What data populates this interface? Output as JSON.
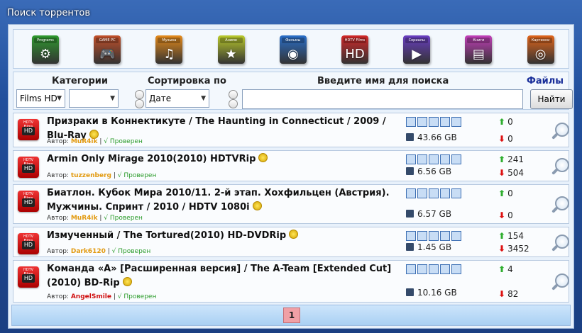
{
  "window": {
    "title": "Поиск торрентов"
  },
  "categories": [
    {
      "tag": "Programs",
      "glyph": "⚙",
      "color": "#2e9a2e",
      "icon": "programs-icon"
    },
    {
      "tag": "GAME PC",
      "glyph": "🎮",
      "color": "#c2502a",
      "icon": "games-icon"
    },
    {
      "tag": "Музыка",
      "glyph": "♫",
      "color": "#e58a1a",
      "icon": "music-icon"
    },
    {
      "tag": "Аниме",
      "glyph": "★",
      "color": "#b9c92b",
      "icon": "anime-icon"
    },
    {
      "tag": "Фильмы",
      "glyph": "◉",
      "color": "#2a6fc9",
      "icon": "movies-icon"
    },
    {
      "tag": "HDTV Films",
      "glyph": "HD",
      "color": "#d22828",
      "icon": "hdtv-icon"
    },
    {
      "tag": "Сериалы",
      "glyph": "▶",
      "color": "#6a3fc2",
      "icon": "series-icon"
    },
    {
      "tag": "Книги",
      "glyph": "▤",
      "color": "#c23fb9",
      "icon": "books-icon"
    },
    {
      "tag": "Картинки",
      "glyph": "◎",
      "color": "#e0651b",
      "icon": "pictures-icon"
    }
  ],
  "search": {
    "categories_label": "Категории",
    "sort_label": "Сортировка по",
    "query_label": "Введите имя для поиска",
    "files_label": "Файлы",
    "category_value": "Films HD",
    "subcategory_value": "",
    "sort_value": "Дате",
    "query_value": "",
    "find_button": "Найти"
  },
  "results": [
    {
      "title": "Призраки в Коннектикуте / The Haunting in Connecticut / 2009 / Blu-Ray",
      "author_label": "Автор:",
      "author": "MuR4ik",
      "author_color": "#e29a10",
      "sep": "|",
      "verified": "√ Проверен",
      "size": "43.66 GB",
      "seeds": "0",
      "leechers": "0"
    },
    {
      "title": "Armin Only Mirage 2010(2010) HDTVRip",
      "author_label": "Автор:",
      "author": "tuzzenberg",
      "author_color": "#e29a10",
      "sep": "|",
      "verified": "√ Проверен",
      "size": "6.56 GB",
      "seeds": "241",
      "leechers": "504"
    },
    {
      "title": "Биатлон. Кубок Мира 2010/11. 2-й этап. Хохфильцен (Австрия). Мужчины. Спринт / 2010 / HDTV 1080i",
      "author_label": "Автор:",
      "author": "MuR4ik",
      "author_color": "#e29a10",
      "sep": "|",
      "verified": "√ Проверен",
      "size": "6.57 GB",
      "seeds": "0",
      "leechers": "0"
    },
    {
      "title": "Измученный / The Tortured(2010) HD-DVDRip",
      "author_label": "Автор:",
      "author": "Dark6120",
      "author_color": "#e29a10",
      "sep": "|",
      "verified": "√ Проверен",
      "size": "1.45 GB",
      "seeds": "154",
      "leechers": "3452"
    },
    {
      "title": "Команда «А» [Расширенная версия] / The A-Team [Extended Cut](2010) BD-Rip",
      "author_label": "Автор:",
      "author": "AngelSmile",
      "author_color": "#d01010",
      "sep": "|",
      "verified": "√ Проверен",
      "size": "10.16 GB",
      "seeds": "4",
      "leechers": "82"
    }
  ],
  "icons": {
    "result": "hdtv-films-icon",
    "coin": "gold-coin-icon",
    "disk": "floppy-disk-icon",
    "seed": "arrow-up-icon",
    "leech": "arrow-down-icon",
    "details": "magnifier-icon"
  },
  "pager": {
    "current": "1"
  }
}
